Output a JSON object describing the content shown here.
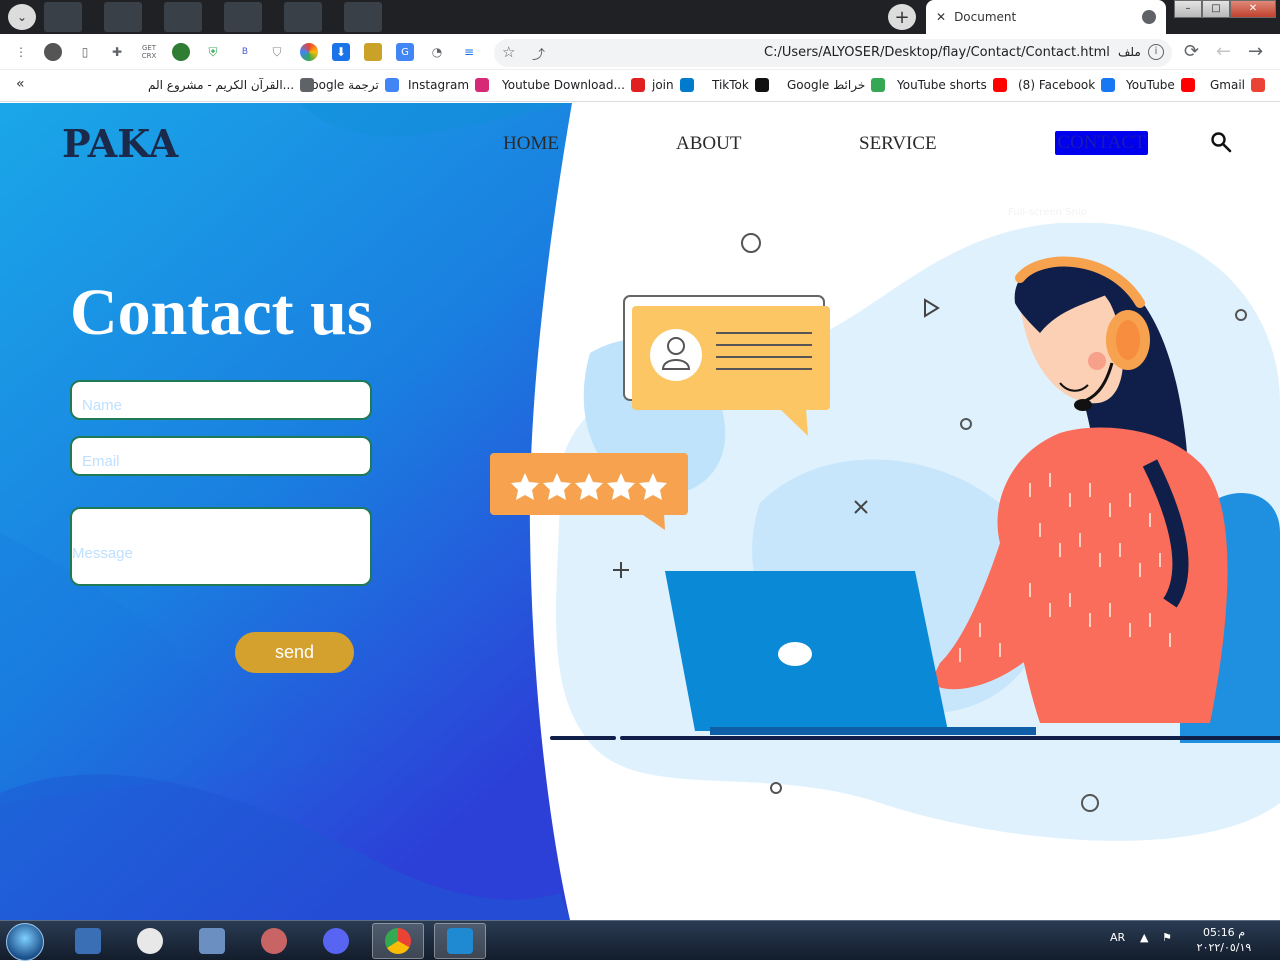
{
  "window": {
    "tab_title": "Document",
    "new_tab_symbol": "+",
    "close_tab_symbol": "✕",
    "controls": {
      "minimize": "–",
      "maximize": "□",
      "close": "✕"
    }
  },
  "toolbar": {
    "url": "C:/Users/ALYOSER/Desktop/flay/Contact/Contact.html",
    "file_chip": "ملف",
    "getcrx_label": "GET CRX",
    "b_label": "B"
  },
  "bookmarks": [
    {
      "label": "Gmail",
      "icon": "gmail-icon",
      "color": "#ea4335"
    },
    {
      "label": "YouTube",
      "icon": "youtube-icon",
      "color": "#ff0000"
    },
    {
      "label": "(8) Facebook",
      "icon": "facebook-icon",
      "color": "#1877f2"
    },
    {
      "label": "YouTube shorts",
      "icon": "youtube-icon",
      "color": "#ff0000"
    },
    {
      "label": "Google خرائط",
      "icon": "maps-pin-icon",
      "color": "#34a853"
    },
    {
      "label": "TikTok",
      "icon": "tiktok-icon",
      "color": "#111111"
    },
    {
      "label": "join",
      "icon": "vscode-icon",
      "color": "#007acc"
    },
    {
      "label": "Youtube Download...",
      "icon": "download-icon",
      "color": "#e02020"
    },
    {
      "label": "Instagram",
      "icon": "instagram-icon",
      "color": "#d62976"
    },
    {
      "label": "Google ترجمة",
      "icon": "translate-icon",
      "color": "#4285f4"
    },
    {
      "label": "القرآن الكريم - مشروع الم...",
      "icon": "globe-icon",
      "color": "#5f6368"
    }
  ],
  "page": {
    "brand": "PAKA",
    "nav": [
      "HOME",
      "ABOUT",
      "SERVICE",
      "CONTACT"
    ],
    "overlay_hint": "Full-screen Snip",
    "title": "Contact us",
    "form": {
      "name_placeholder": "Name",
      "email_placeholder": "Email",
      "message_placeholder": "Message",
      "send_label": "send"
    }
  },
  "colors": {
    "panel_blue_light": "#1aa7e8",
    "panel_blue_dark": "#2c40d8",
    "send_button": "#d4a02e",
    "field_border": "#1f7a55",
    "contact_highlight": "#0000ee"
  },
  "taskbar": {
    "apps": [
      "windows-explorer-icon",
      "wireshark-icon",
      "network-icon",
      "snipping-tool-icon",
      "discord-icon",
      "chrome-icon",
      "vscode-icon"
    ],
    "language": "AR",
    "time": "05:16 م",
    "date": "٢٠٢٢/٠٥/١٩"
  }
}
